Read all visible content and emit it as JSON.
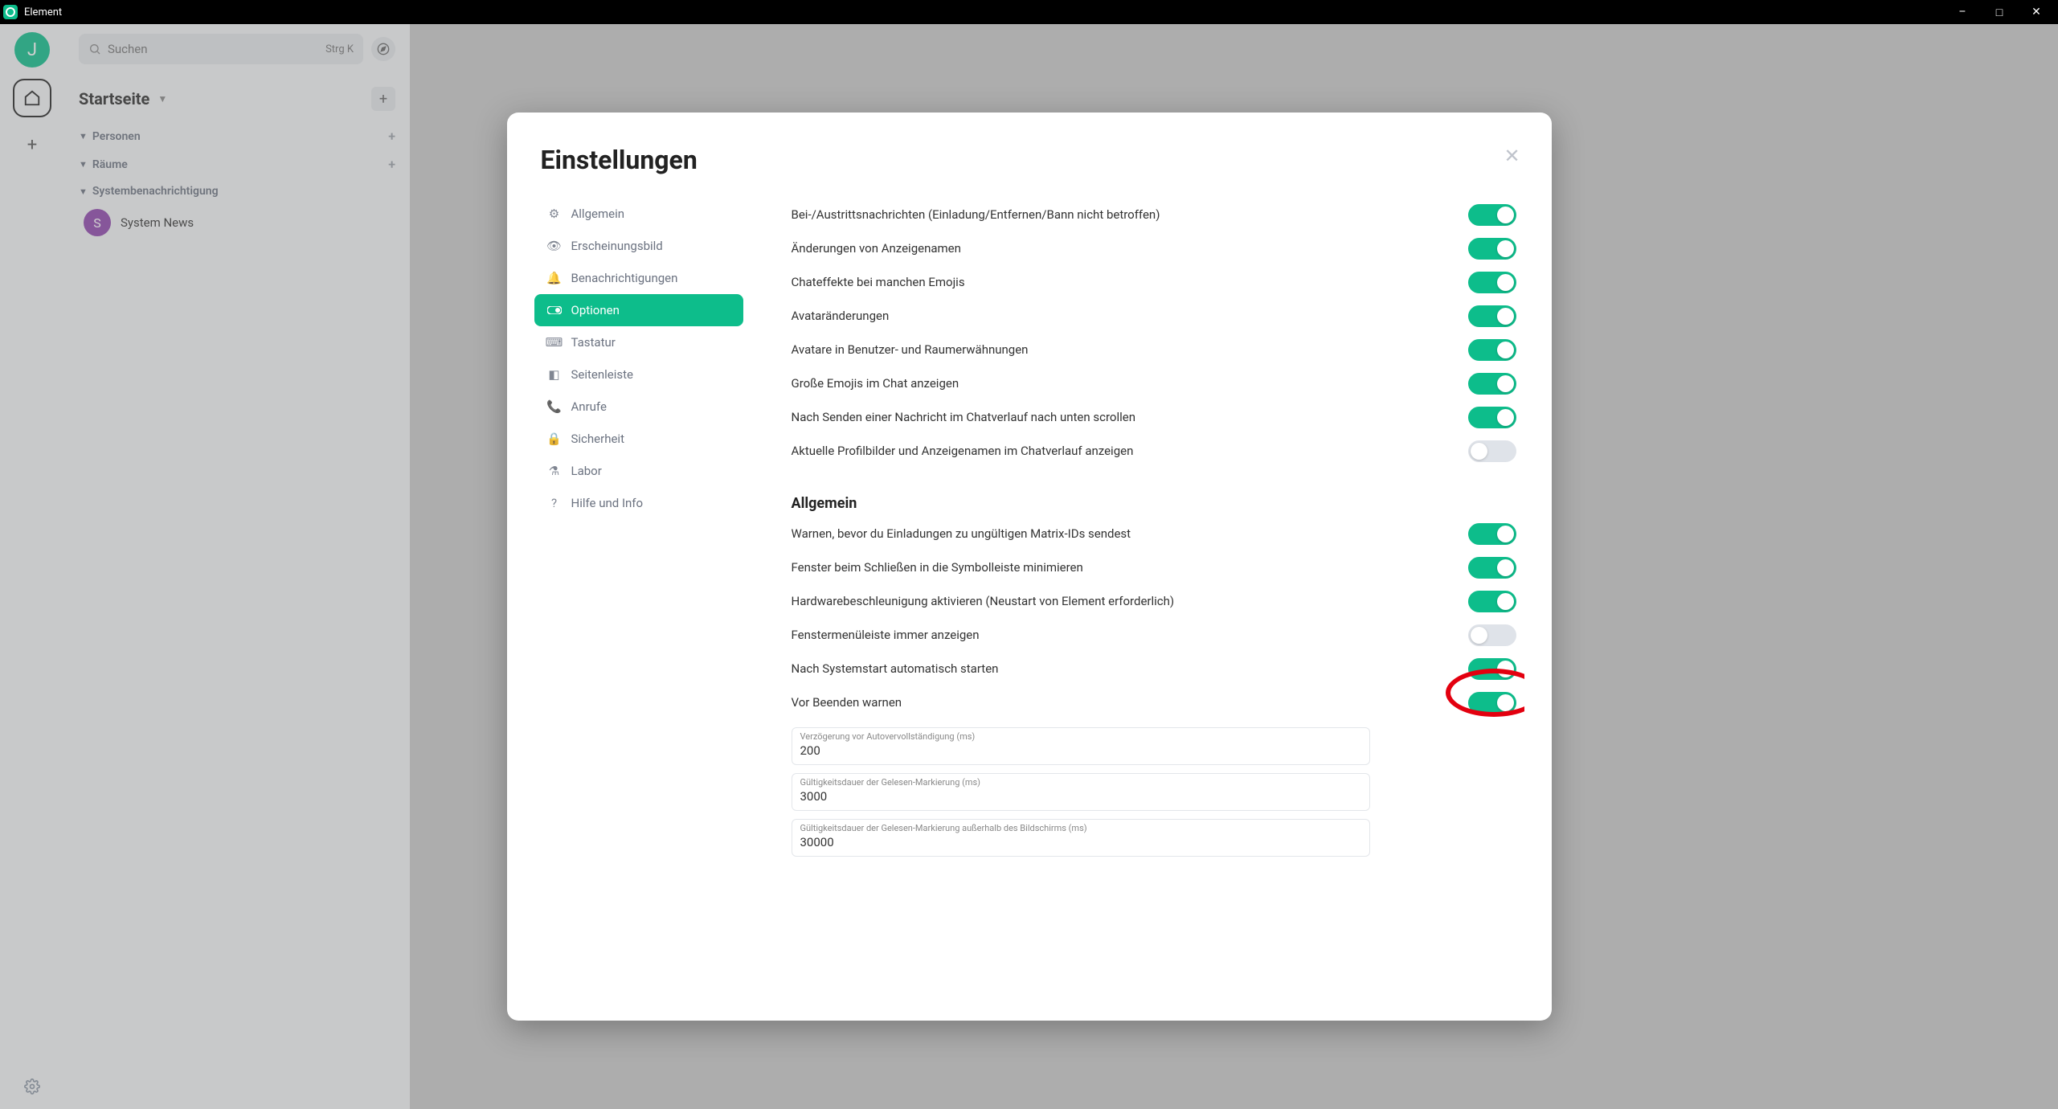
{
  "titlebar": {
    "app_name": "Element"
  },
  "rail": {
    "avatar_initial": "J"
  },
  "search": {
    "placeholder": "Suchen",
    "kbd": "Strg K"
  },
  "sidebar": {
    "home_title": "Startseite",
    "sections": {
      "people": "Personen",
      "rooms": "Räume",
      "sysnotif": "Systembenachrichtigung"
    },
    "room_item": {
      "initial": "S",
      "name": "System News"
    }
  },
  "dialog": {
    "title": "Einstellungen",
    "nav": {
      "allgemein": "Allgemein",
      "erscheinung": "Erscheinungsbild",
      "benachrichtigung": "Benachrichtigungen",
      "optionen": "Optionen",
      "tastatur": "Tastatur",
      "seitenleiste": "Seitenleiste",
      "anrufe": "Anrufe",
      "sicherheit": "Sicherheit",
      "labor": "Labor",
      "hilfe": "Hilfe und Info"
    },
    "toggles1": [
      {
        "label": "Bei-/Austrittsnachrichten (Einladung/Entfernen/Bann nicht betroffen)",
        "on": true
      },
      {
        "label": "Änderungen von Anzeigenamen",
        "on": true
      },
      {
        "label": "Chateffekte bei manchen Emojis",
        "on": true
      },
      {
        "label": "Avataränderungen",
        "on": true
      },
      {
        "label": "Avatare in Benutzer- und Raumerwähnungen",
        "on": true
      },
      {
        "label": "Große Emojis im Chat anzeigen",
        "on": true
      },
      {
        "label": "Nach Senden einer Nachricht im Chatverlauf nach unten scrollen",
        "on": true
      },
      {
        "label": "Aktuelle Profilbilder und Anzeigenamen im Chatverlauf anzeigen",
        "on": false
      }
    ],
    "section2_heading": "Allgemein",
    "toggles2": [
      {
        "label": "Warnen, bevor du Einladungen zu ungültigen Matrix-IDs sendest",
        "on": true
      },
      {
        "label": "Fenster beim Schließen in die Symbolleiste minimieren",
        "on": true
      },
      {
        "label": "Hardwarebeschleunigung aktivieren (Neustart von Element erforderlich)",
        "on": true
      },
      {
        "label": "Fenstermenüleiste immer anzeigen",
        "on": false
      },
      {
        "label": "Nach Systemstart automatisch starten",
        "on": true
      },
      {
        "label": "Vor Beenden warnen",
        "on": true
      }
    ],
    "fields": [
      {
        "label": "Verzögerung vor Autovervollständigung (ms)",
        "value": "200"
      },
      {
        "label": "Gültigkeitsdauer der Gelesen-Markierung (ms)",
        "value": "3000"
      },
      {
        "label": "Gültigkeitsdauer der Gelesen-Markierung außerhalb des Bildschirms (ms)",
        "value": "30000"
      }
    ]
  }
}
